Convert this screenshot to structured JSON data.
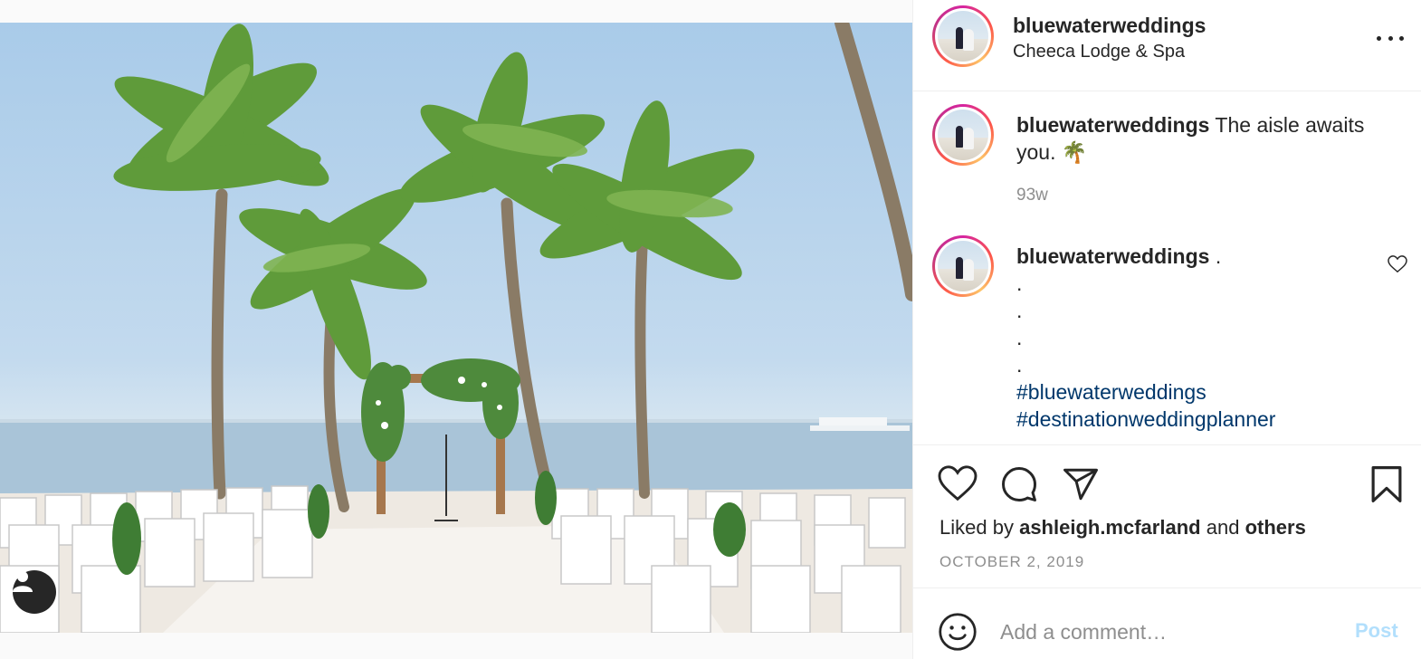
{
  "post": {
    "image_alt": "Beach wedding ceremony with palm trees, floral arch and white chairs",
    "user_tag_icon": "user-icon"
  },
  "header": {
    "username": "bluewaterweddings",
    "location": "Cheeca Lodge & Spa",
    "more_icon": "more-horizontal-icon"
  },
  "caption": {
    "username": "bluewaterweddings",
    "text": "The aisle awaits you. 🌴",
    "time": "93w"
  },
  "comment": {
    "username": "bluewaterweddings",
    "first_line": ".",
    "dots": [
      ".",
      ".",
      ".",
      "."
    ],
    "hashtags": [
      "#bluewaterweddings",
      "#destinationweddingplanner"
    ]
  },
  "actions": {
    "like_icon": "heart-icon",
    "comment_icon": "comment-icon",
    "share_icon": "send-icon",
    "save_icon": "bookmark-icon"
  },
  "likes": {
    "prefix": "Liked by",
    "user": "ashleigh.mcfarland",
    "conj": "and",
    "others": "others"
  },
  "date": "OCTOBER 2, 2019",
  "add_comment": {
    "placeholder": "Add a comment…",
    "post_label": "Post",
    "emoji_icon": "smiley-icon"
  },
  "colors": {
    "link": "#00376b",
    "muted": "#8e8e8e",
    "post_disabled": "#b2dffc"
  }
}
